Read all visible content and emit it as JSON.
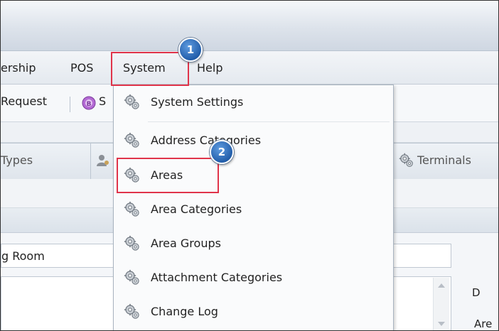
{
  "menubar": {
    "items": [
      "ership",
      "POS",
      "System",
      "Help"
    ]
  },
  "toolbar": {
    "request_label": "Request",
    "s_label": "S"
  },
  "tabs": {
    "types_label": "Types",
    "terminals_label": "Terminals"
  },
  "form": {
    "field_value": "g Room",
    "side_label_1": "D",
    "side_label_2": "Are"
  },
  "system_menu": {
    "items": [
      {
        "label": "System Settings",
        "icon": "gears-icon"
      },
      {
        "label": "Address Categories",
        "icon": "gears-icon"
      },
      {
        "label": "Areas",
        "icon": "gears-icon"
      },
      {
        "label": "Area Categories",
        "icon": "gears-icon"
      },
      {
        "label": "Area Groups",
        "icon": "gears-icon"
      },
      {
        "label": "Attachment Categories",
        "icon": "gears-icon"
      },
      {
        "label": "Change Log",
        "icon": "gears-icon"
      }
    ]
  },
  "callouts": {
    "step1": "1",
    "step2": "2",
    "highlight_color": "#e0344a",
    "badge_color": "#2a6bbf"
  }
}
